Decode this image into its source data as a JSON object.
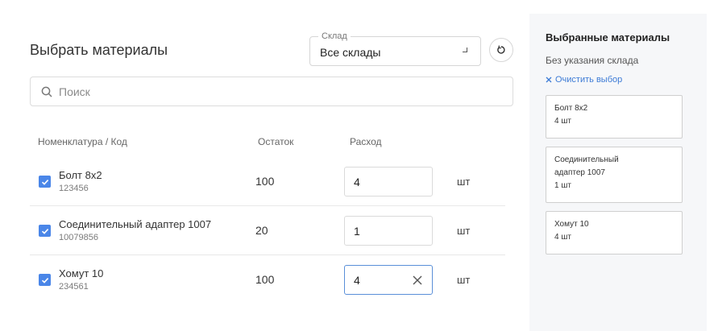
{
  "header": {
    "title": "Выбрать материалы"
  },
  "warehouse": {
    "label": "Склад",
    "value": "Все склады"
  },
  "search": {
    "placeholder": "Поиск"
  },
  "table": {
    "columns": {
      "name": "Номенклатура / Код",
      "stock": "Остаток",
      "consumption": "Расход"
    },
    "rows": [
      {
        "name": "Болт 8x2",
        "code": "123456",
        "stock": "100",
        "qty": "4",
        "unit": "шт",
        "checked": true
      },
      {
        "name": "Соединительный адаптер 1007",
        "code": "10079856",
        "stock": "20",
        "qty": "1",
        "unit": "шт",
        "checked": true
      },
      {
        "name": "Хомут 10",
        "code": "234561",
        "stock": "100",
        "qty": "4",
        "unit": "шт",
        "checked": true
      }
    ]
  },
  "sidebar": {
    "title": "Выбранные материалы",
    "subtitle": "Без указания склада",
    "clear_label": "Очистить выбор",
    "cards": [
      {
        "name": "Болт 8x2",
        "qty": "4 шт"
      },
      {
        "name_line1": "Соединительный",
        "name_line2": "адаптер 1007",
        "qty": "1 шт"
      },
      {
        "name": "Хомут 10",
        "qty": "4 шт"
      }
    ]
  },
  "colors": {
    "accent": "#4a86e8",
    "link": "#3d7bd6",
    "sidebar_bg": "#f6f7f9"
  },
  "icons": {
    "refresh": "refresh-icon",
    "search": "search-icon",
    "clear": "close-icon",
    "check": "check-icon"
  }
}
